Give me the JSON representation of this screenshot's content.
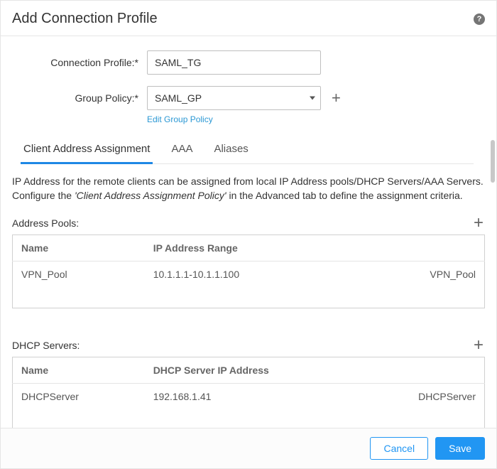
{
  "dialog": {
    "title": "Add Connection Profile"
  },
  "form": {
    "connection_profile_label": "Connection Profile:",
    "connection_profile_value": "SAML_TG",
    "group_policy_label": "Group Policy:",
    "group_policy_value": "SAML_GP",
    "edit_group_policy": "Edit Group Policy",
    "required": "*"
  },
  "tabs": {
    "client_address": "Client Address Assignment",
    "aaa": "AAA",
    "aliases": "Aliases",
    "active": 0
  },
  "content": {
    "description_pre": "IP Address for the remote clients can be assigned from local IP Address pools/DHCP Servers/AAA Servers. Configure the ",
    "description_em": "'Client Address Assignment Policy'",
    "description_post": " in the Advanced tab to define the assignment criteria.",
    "address_pools": {
      "title": "Address Pools:",
      "columns": {
        "name": "Name",
        "range": "IP Address Range"
      },
      "rows": [
        {
          "name": "VPN_Pool",
          "range": "10.1.1.1-10.1.1.100",
          "right": "VPN_Pool"
        }
      ]
    },
    "dhcp_servers": {
      "title": "DHCP Servers:",
      "columns": {
        "name": "Name",
        "ip": "DHCP Server IP Address"
      },
      "rows": [
        {
          "name": "DHCPServer",
          "ip": "192.168.1.41",
          "right": "DHCPServer"
        }
      ]
    }
  },
  "footer": {
    "cancel": "Cancel",
    "save": "Save"
  }
}
